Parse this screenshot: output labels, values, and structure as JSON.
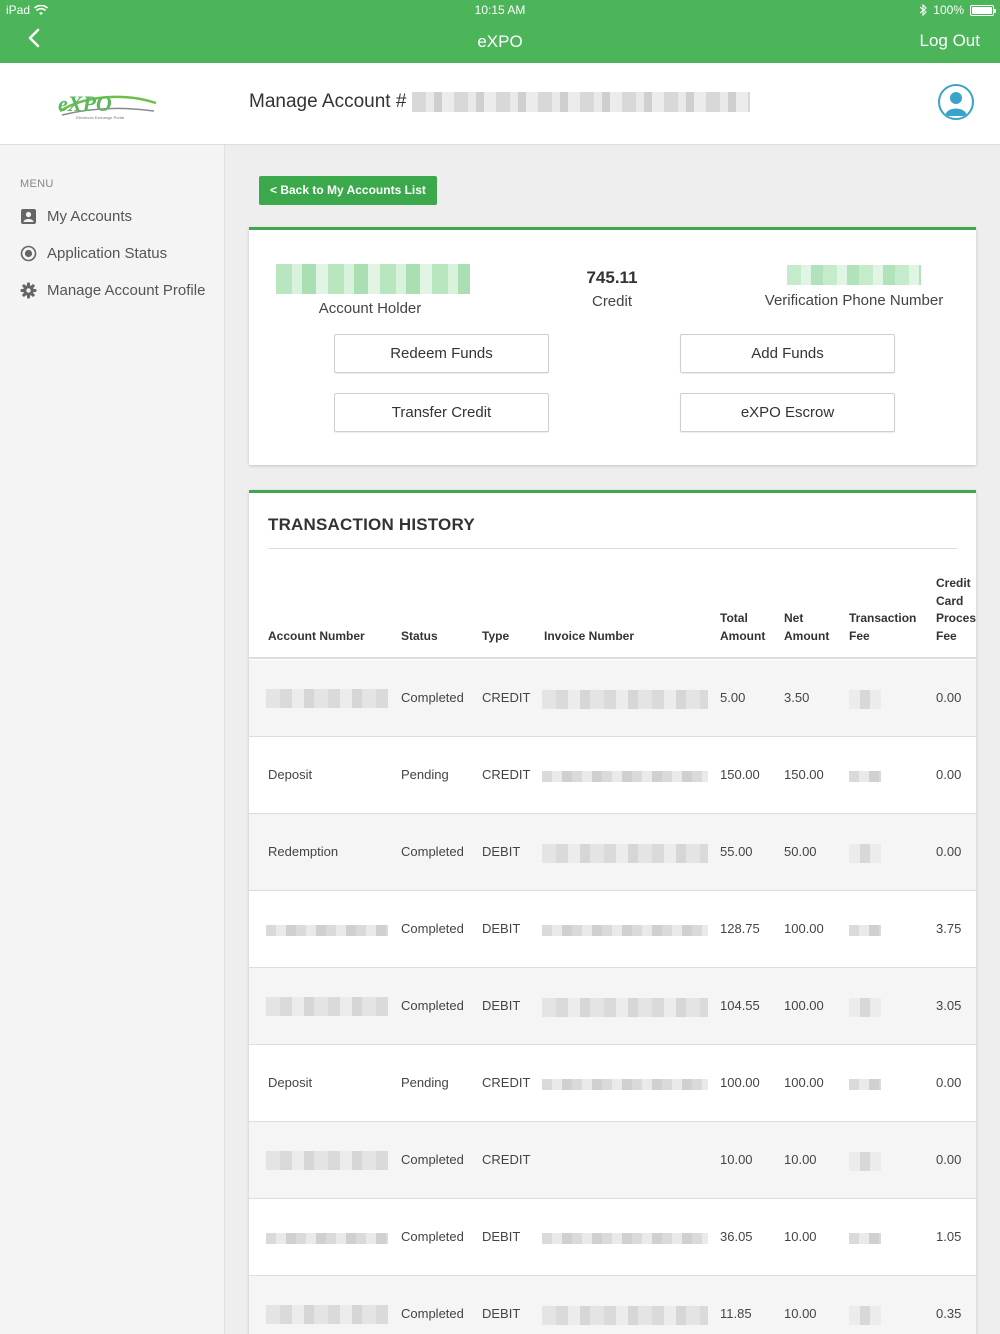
{
  "status_bar": {
    "device": "iPad",
    "time": "10:15 AM",
    "battery": "100%"
  },
  "app_bar": {
    "title": "eXPO",
    "logout_label": "Log Out"
  },
  "header": {
    "title": "Manage Account #"
  },
  "logo": {
    "text": "eXPO",
    "tagline": "Electronic Exchange Portal"
  },
  "sidebar": {
    "menu_label": "MENU",
    "items": [
      {
        "label": "My Accounts",
        "icon": "account-box-icon"
      },
      {
        "label": "Application Status",
        "icon": "radio-dot-icon"
      },
      {
        "label": "Manage Account Profile",
        "icon": "gear-icon"
      }
    ]
  },
  "back_button": "< Back to My Accounts List",
  "account": {
    "holder_label": "Account Holder",
    "credit_value": "745.11",
    "credit_label": "Credit",
    "phone_label": "Verification Phone Number",
    "buttons": {
      "redeem": "Redeem Funds",
      "add": "Add Funds",
      "transfer": "Transfer Credit",
      "escrow": "eXPO Escrow"
    }
  },
  "history": {
    "title": "TRANSACTION HISTORY",
    "headers": {
      "account": "Account Number",
      "status": "Status",
      "type": "Type",
      "invoice": "Invoice Number",
      "total": "Total Amount",
      "net": "Net Amount",
      "fee": "Transaction Fee",
      "cc": "Credit Card Processing Fee"
    },
    "rows": [
      {
        "account": "",
        "status": "Completed",
        "type": "CREDIT",
        "total": "5.00",
        "net": "3.50",
        "cc": "0.00"
      },
      {
        "account": "Deposit",
        "status": "Pending",
        "type": "CREDIT",
        "total": "150.00",
        "net": "150.00",
        "cc": "0.00"
      },
      {
        "account": "Redemption",
        "status": "Completed",
        "type": "DEBIT",
        "total": "55.00",
        "net": "50.00",
        "cc": "0.00"
      },
      {
        "account": "",
        "status": "Completed",
        "type": "DEBIT",
        "total": "128.75",
        "net": "100.00",
        "cc": "3.75"
      },
      {
        "account": "",
        "status": "Completed",
        "type": "DEBIT",
        "total": "104.55",
        "net": "100.00",
        "cc": "3.05"
      },
      {
        "account": "Deposit",
        "status": "Pending",
        "type": "CREDIT",
        "total": "100.00",
        "net": "100.00",
        "cc": "0.00"
      },
      {
        "account": "",
        "status": "Completed",
        "type": "CREDIT",
        "total": "10.00",
        "net": "10.00",
        "cc": "0.00"
      },
      {
        "account": "",
        "status": "Completed",
        "type": "DEBIT",
        "total": "36.05",
        "net": "10.00",
        "cc": "1.05"
      },
      {
        "account": "",
        "status": "Completed",
        "type": "DEBIT",
        "total": "11.85",
        "net": "10.00",
        "cc": "0.35"
      }
    ]
  },
  "colors": {
    "brand_green": "#4cb55a",
    "button_green": "#3aa84b",
    "avatar_blue": "#3aa3c9"
  }
}
